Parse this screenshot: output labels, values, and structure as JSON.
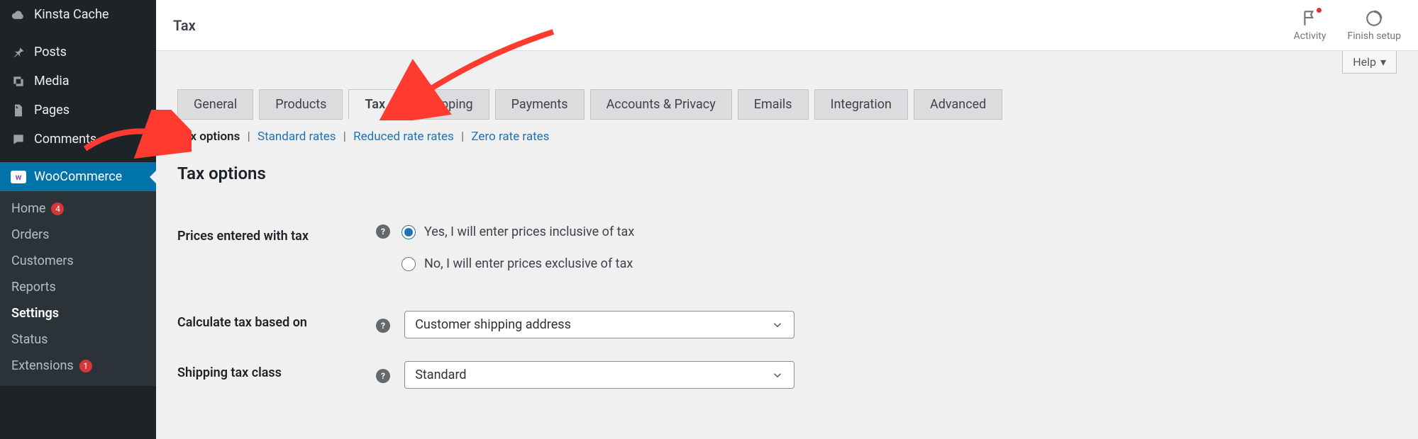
{
  "sidebar": {
    "items": [
      {
        "label": "Kinsta Cache",
        "icon": "cloud"
      },
      {
        "label": "Posts",
        "icon": "pin"
      },
      {
        "label": "Media",
        "icon": "media"
      },
      {
        "label": "Pages",
        "icon": "page"
      },
      {
        "label": "Comments",
        "icon": "comment"
      },
      {
        "label": "WooCommerce",
        "icon": "woo",
        "active": true
      }
    ],
    "submenu": [
      {
        "label": "Home",
        "badge": "4"
      },
      {
        "label": "Orders"
      },
      {
        "label": "Customers"
      },
      {
        "label": "Reports"
      },
      {
        "label": "Settings",
        "active": true
      },
      {
        "label": "Status"
      },
      {
        "label": "Extensions",
        "badge": "1"
      }
    ]
  },
  "header": {
    "title": "Tax",
    "right": {
      "activity": "Activity",
      "finish": "Finish setup"
    }
  },
  "help_label": "Help",
  "tabs": [
    "General",
    "Products",
    "Tax",
    "Shipping",
    "Payments",
    "Accounts & Privacy",
    "Emails",
    "Integration",
    "Advanced"
  ],
  "tabs_active_index": 2,
  "sections": {
    "current": "Tax options",
    "links": [
      "Standard rates",
      "Reduced rate rates",
      "Zero rate rates"
    ]
  },
  "form": {
    "title": "Tax options",
    "prices_label": "Prices entered with tax",
    "prices_opts": {
      "yes": "Yes, I will enter prices inclusive of tax",
      "no": "No, I will enter prices exclusive of tax"
    },
    "calc_label": "Calculate tax based on",
    "calc_value": "Customer shipping address",
    "ship_label": "Shipping tax class",
    "ship_value": "Standard"
  }
}
